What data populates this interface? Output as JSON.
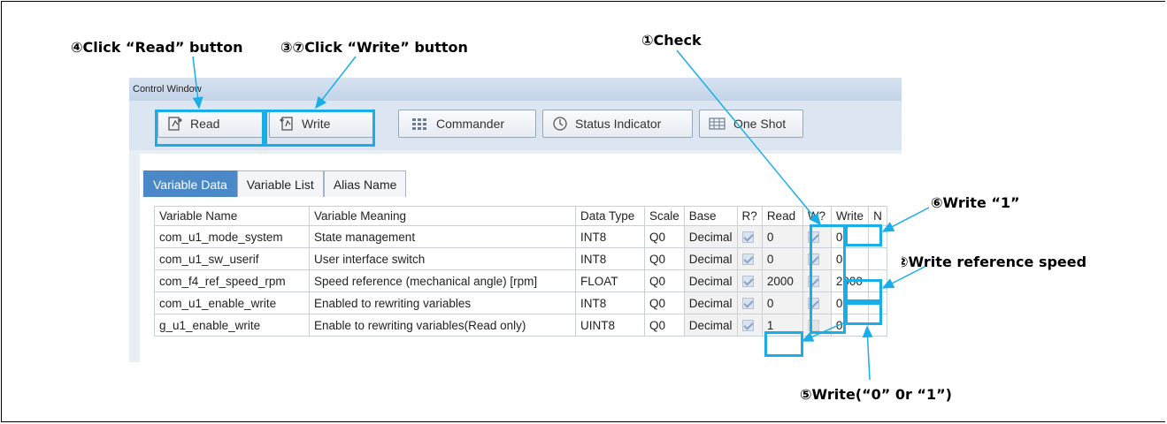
{
  "callouts": {
    "read": "④Click “Read” button",
    "write": "③⑦Click “Write” button",
    "check": "①Check",
    "write1": "⑥Write “1”",
    "write_ref": "②Write reference speed",
    "write01": "⑤Write(“0” 0r “1”)"
  },
  "window": {
    "title": "Control Window",
    "toolbar": [
      {
        "label": "Read",
        "icon": "read-icon"
      },
      {
        "label": "Write",
        "icon": "write-icon"
      },
      {
        "label": "Commander",
        "icon": "commander-icon"
      },
      {
        "label": "Status Indicator",
        "icon": "status-indicator-icon"
      },
      {
        "label": "One Shot",
        "icon": "one-shot-icon"
      }
    ],
    "tabs": [
      "Variable Data",
      "Variable List",
      "Alias Name"
    ],
    "columns": [
      "Variable Name",
      "Variable Meaning",
      "Data Type",
      "Scale",
      "Base",
      "R?",
      "Read",
      "W?",
      "Write",
      "N"
    ],
    "rows": [
      {
        "name": "com_u1_mode_system",
        "meaning": "State management",
        "type": "INT8",
        "scale": "Q0",
        "base": "Decimal",
        "r": true,
        "read": "0",
        "w": true,
        "write": "0"
      },
      {
        "name": "com_u1_sw_userif",
        "meaning": "User interface switch",
        "type": "INT8",
        "scale": "Q0",
        "base": "Decimal",
        "r": true,
        "read": "0",
        "w": true,
        "write": "0"
      },
      {
        "name": "com_f4_ref_speed_rpm",
        "meaning": "Speed reference (mechanical angle) [rpm]",
        "type": "FLOAT",
        "scale": "Q0",
        "base": "Decimal",
        "r": true,
        "read": "2000",
        "w": true,
        "write": "2000"
      },
      {
        "name": "com_u1_enable_write",
        "meaning": "Enabled to rewriting variables",
        "type": "INT8",
        "scale": "Q0",
        "base": "Decimal",
        "r": true,
        "read": "0",
        "w": true,
        "write": "0"
      },
      {
        "name": "g_u1_enable_write",
        "meaning": "Enable to rewriting variables(Read only)",
        "type": "UINT8",
        "scale": "Q0",
        "base": "Decimal",
        "r": true,
        "read": "1",
        "w": false,
        "write": "0"
      }
    ]
  },
  "colors": {
    "highlight": "#19aee8",
    "active_tab": "#4a88c7"
  }
}
